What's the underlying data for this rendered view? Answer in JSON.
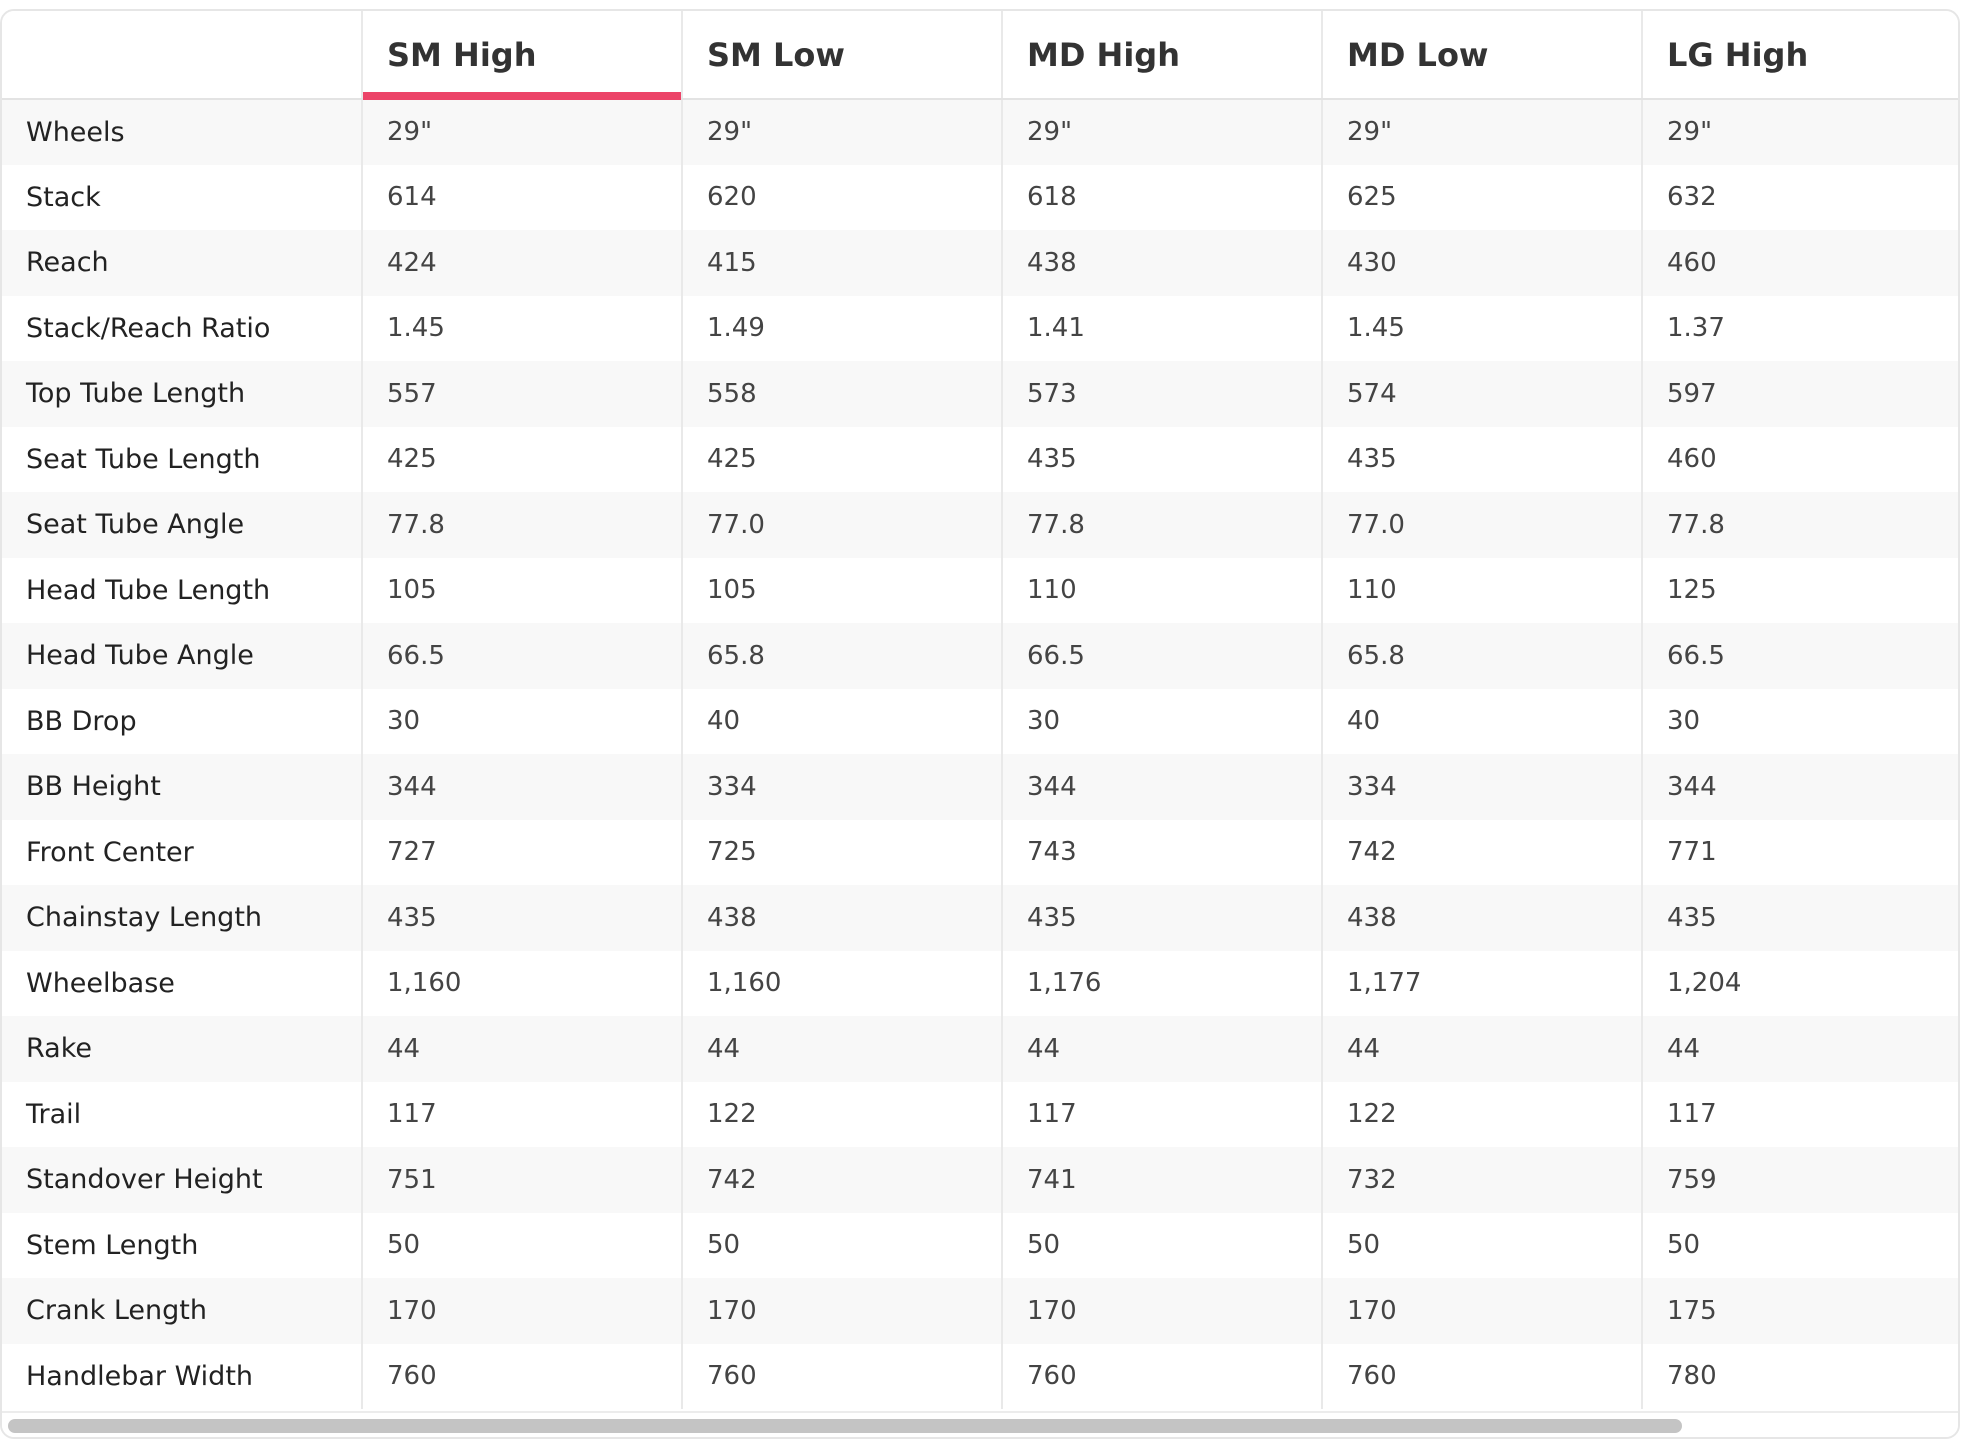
{
  "table": {
    "corner": "",
    "columns": [
      "SM High",
      "SM Low",
      "MD High",
      "MD Low",
      "LG High"
    ],
    "active_column": 0,
    "rows": [
      {
        "label": "Wheels",
        "values": [
          "29\"",
          "29\"",
          "29\"",
          "29\"",
          "29\""
        ]
      },
      {
        "label": "Stack",
        "values": [
          "614",
          "620",
          "618",
          "625",
          "632"
        ]
      },
      {
        "label": "Reach",
        "values": [
          "424",
          "415",
          "438",
          "430",
          "460"
        ]
      },
      {
        "label": "Stack/Reach Ratio",
        "values": [
          "1.45",
          "1.49",
          "1.41",
          "1.45",
          "1.37"
        ]
      },
      {
        "label": "Top Tube Length",
        "values": [
          "557",
          "558",
          "573",
          "574",
          "597"
        ]
      },
      {
        "label": "Seat Tube Length",
        "values": [
          "425",
          "425",
          "435",
          "435",
          "460"
        ]
      },
      {
        "label": "Seat Tube Angle",
        "values": [
          "77.8",
          "77.0",
          "77.8",
          "77.0",
          "77.8"
        ]
      },
      {
        "label": "Head Tube Length",
        "values": [
          "105",
          "105",
          "110",
          "110",
          "125"
        ]
      },
      {
        "label": "Head Tube Angle",
        "values": [
          "66.5",
          "65.8",
          "66.5",
          "65.8",
          "66.5"
        ]
      },
      {
        "label": "BB Drop",
        "values": [
          "30",
          "40",
          "30",
          "40",
          "30"
        ]
      },
      {
        "label": "BB Height",
        "values": [
          "344",
          "334",
          "344",
          "334",
          "344"
        ]
      },
      {
        "label": "Front Center",
        "values": [
          "727",
          "725",
          "743",
          "742",
          "771"
        ]
      },
      {
        "label": "Chainstay Length",
        "values": [
          "435",
          "438",
          "435",
          "438",
          "435"
        ]
      },
      {
        "label": "Wheelbase",
        "values": [
          "1,160",
          "1,160",
          "1,176",
          "1,177",
          "1,204"
        ]
      },
      {
        "label": "Rake",
        "values": [
          "44",
          "44",
          "44",
          "44",
          "44"
        ]
      },
      {
        "label": "Trail",
        "values": [
          "117",
          "122",
          "117",
          "122",
          "117"
        ]
      },
      {
        "label": "Standover Height",
        "values": [
          "751",
          "742",
          "741",
          "732",
          "759"
        ]
      },
      {
        "label": "Stem Length",
        "values": [
          "50",
          "50",
          "50",
          "50",
          "50"
        ]
      },
      {
        "label": "Crank Length",
        "values": [
          "170",
          "170",
          "170",
          "170",
          "175"
        ]
      },
      {
        "label": "Handlebar Width",
        "values": [
          "760",
          "760",
          "760",
          "760",
          "780"
        ]
      }
    ]
  },
  "colors": {
    "active_tab_underline": "#ec4468",
    "row_stripe": "#f8f8f8",
    "border": "#e9e9e9",
    "scrollbar_thumb": "#c4c4c4"
  }
}
